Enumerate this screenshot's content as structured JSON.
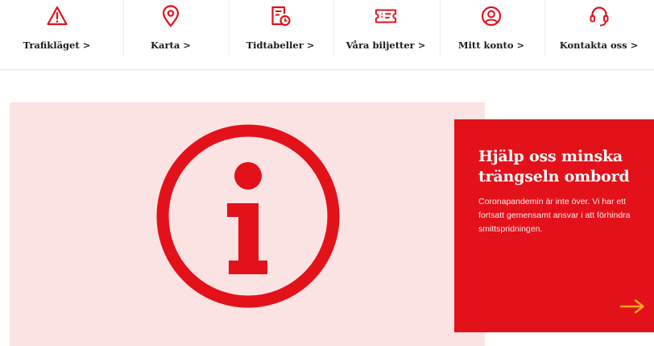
{
  "nav": {
    "items": [
      {
        "label": "Trafikläget >",
        "icon": "warning-triangle-icon"
      },
      {
        "label": "Karta >",
        "icon": "map-pin-icon"
      },
      {
        "label": "Tidtabeller >",
        "icon": "timetable-clock-icon"
      },
      {
        "label": "Våra biljetter >",
        "icon": "ticket-icon"
      },
      {
        "label": "Mitt konto >",
        "icon": "user-account-icon"
      },
      {
        "label": "Kontakta oss >",
        "icon": "headset-icon"
      }
    ]
  },
  "hero": {
    "icon": "info-icon",
    "title": "Hjälp oss minska trängseln ombord",
    "body": "Coronapandemin är inte över. Vi har ett fortsatt gemensamt ansvar i att förhindra smittspridningen.",
    "arrow_icon": "arrow-right-icon"
  },
  "colors": {
    "brand_red": "#e3111a",
    "hero_bg": "#fbe2e3",
    "arrow_yellow": "#f7a823"
  }
}
